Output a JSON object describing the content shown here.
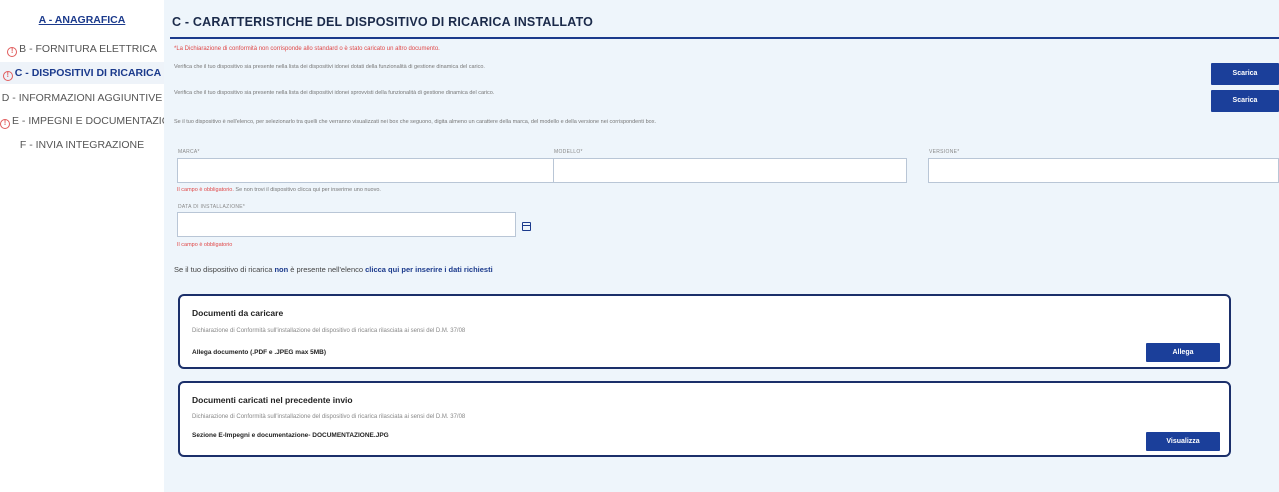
{
  "sidebar": {
    "items": [
      {
        "label": "A - ANAGRAFICA",
        "warning": false
      },
      {
        "label": "B - FORNITURA ELETTRICA",
        "warning": true
      },
      {
        "label": "C - DISPOSITIVI DI RICARICA",
        "warning": true
      },
      {
        "label": "D - INFORMAZIONI AGGIUNTIVE",
        "warning": false
      },
      {
        "label": "E - IMPEGNI E DOCUMENTAZIONE",
        "warning": true
      },
      {
        "label": "F - INVIA INTEGRAZIONE",
        "warning": false
      }
    ],
    "warning_glyph": "!"
  },
  "section": {
    "title": "C - CARATTERISTICHE DEL DISPOSITIVO DI RICARICA INSTALLATO",
    "error_notice": "*La Dichiarazione di conformità non corrisponde allo standard o è stato caricato un altro documento.",
    "verify_dynamic": "Verifica che il tuo dispositivo sia presente nella lista dei dispositivi idonei dotati della funzionalità di gestione dinamica del carico.",
    "verify_static": "Verifica che il tuo dispositivo sia presente nella lista dei dispositivi idonei sprovvisti della funzionalità di gestione dinamica del carico.",
    "instructions": "Se il tuo dispositivo è nell'elenco, per selezionarlo tra quelli che verranno visualizzati nei box che seguono, digita almeno un carattere della marca, del modello e della versione nei corrispondenti box.",
    "download_label": "Scarica"
  },
  "form": {
    "brand_label": "MARCA*",
    "model_label": "MODELLO*",
    "version_label": "VERSIONE*",
    "brand_error": "Il campo è obbligatorio.",
    "brand_hint": " Se non trovi il dispositivo clicca qui per inserirne uno nuovo.",
    "date_label": "DATA DI INSTALLAZIONE*",
    "date_error": "Il campo è obbligatorio"
  },
  "not_listed": {
    "prefix": "Se il tuo dispositivo di ricarica ",
    "emph": "non",
    "middle": " è presente nell'elenco ",
    "link": "clicca qui per inserire i dati richiesti"
  },
  "upload_card": {
    "title": "Documenti da caricare",
    "description": "Dichiarazione di Conformità sull'installazione del dispositivo di ricarica rilasciata ai sensi del D.M. 37/08",
    "doc_label": "Allega documento (.PDF e .JPEG max 5MB)",
    "button": "Allega"
  },
  "previous_card": {
    "title": "Documenti caricati nel precedente invio",
    "description": "Dichiarazione di Conformità sull'installazione del dispositivo di ricarica rilasciata ai sensi del D.M. 37/08",
    "doc_label": "Sezione E-Impegni e documentazione- DOCUMENTAZIONE.JPG",
    "button": "Visualizza"
  },
  "colors": {
    "primary": "#1b3f9a",
    "error": "#e04848",
    "background": "#eef5fb"
  }
}
